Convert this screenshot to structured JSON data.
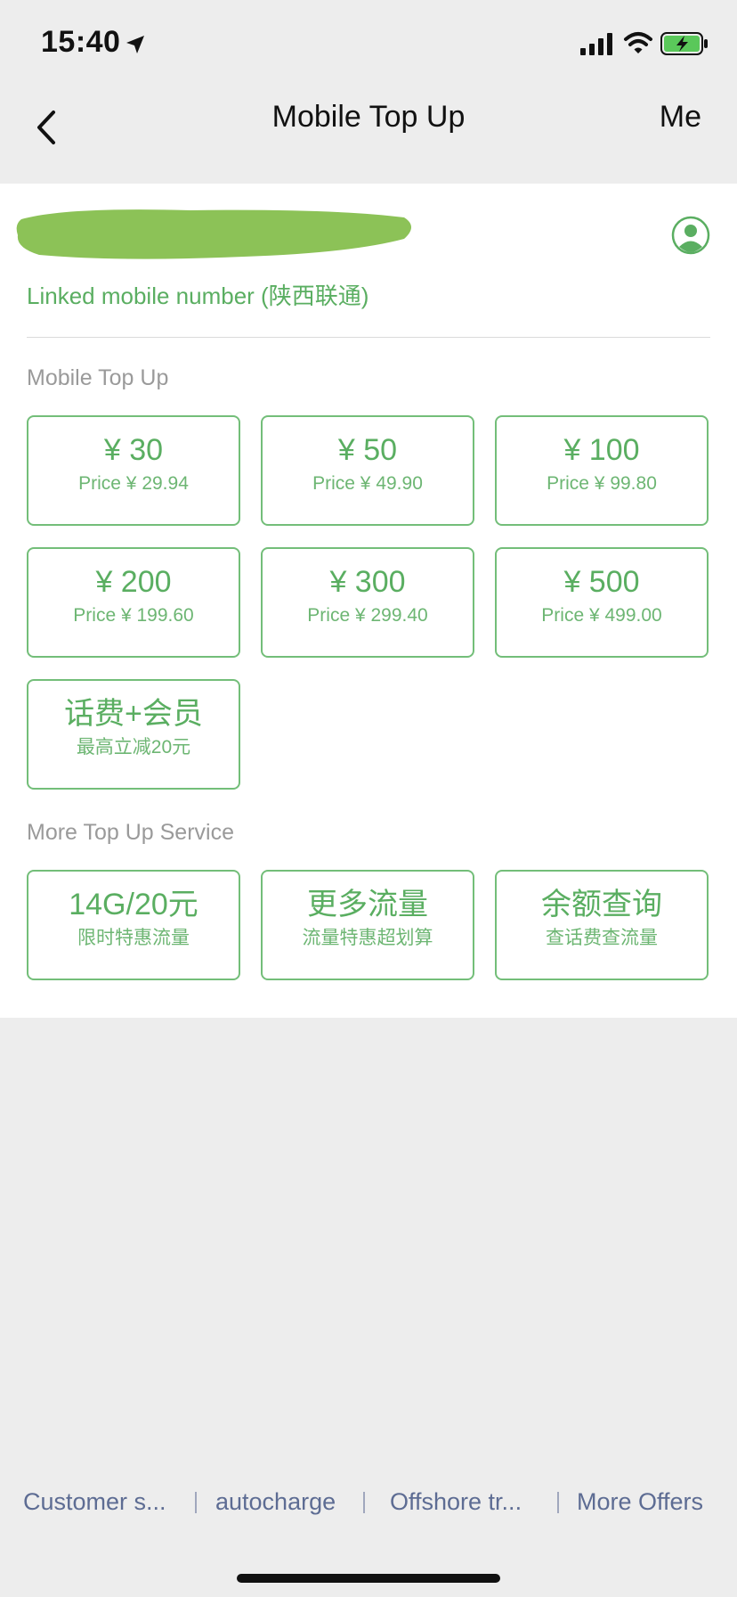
{
  "status_bar": {
    "time": "15:40",
    "icons": [
      "location-arrow-icon",
      "signal-icon",
      "wifi-icon",
      "battery-charging-icon"
    ]
  },
  "nav": {
    "title": "Mobile Top Up",
    "right_label": "Me",
    "back_icon": "chevron-left-icon"
  },
  "account": {
    "linked_number_label": "Linked mobile number (陕西联通)",
    "avatar_icon": "user-avatar-icon",
    "mask_color": "#8CC257"
  },
  "mobile_topup": {
    "label": "Mobile Top Up",
    "options": [
      {
        "amount": "¥ 30",
        "price": "Price ¥ 29.94"
      },
      {
        "amount": "¥ 50",
        "price": "Price ¥ 49.90"
      },
      {
        "amount": "¥ 100",
        "price": "Price ¥ 99.80"
      },
      {
        "amount": "¥ 200",
        "price": "Price ¥ 199.60"
      },
      {
        "amount": "¥ 300",
        "price": "Price ¥ 299.40"
      },
      {
        "amount": "¥ 500",
        "price": "Price ¥ 499.00"
      },
      {
        "amount": "话费+会员",
        "price": "最高立减20元"
      }
    ]
  },
  "more_service": {
    "label": "More Top Up Service",
    "options": [
      {
        "title": "14G/20元",
        "subtitle": "限时特惠流量"
      },
      {
        "title": "更多流量",
        "subtitle": "流量特惠超划算"
      },
      {
        "title": "余额查询",
        "subtitle": "查话费查流量"
      }
    ]
  },
  "footer": {
    "links": [
      "Customer s...",
      "autocharge",
      "Offshore tr...",
      "More Offers"
    ]
  },
  "colors": {
    "accent_green": "#5AAE61",
    "tile_border": "#73BE79",
    "footer_link": "#5D6C93",
    "background": "#EDEDED"
  }
}
